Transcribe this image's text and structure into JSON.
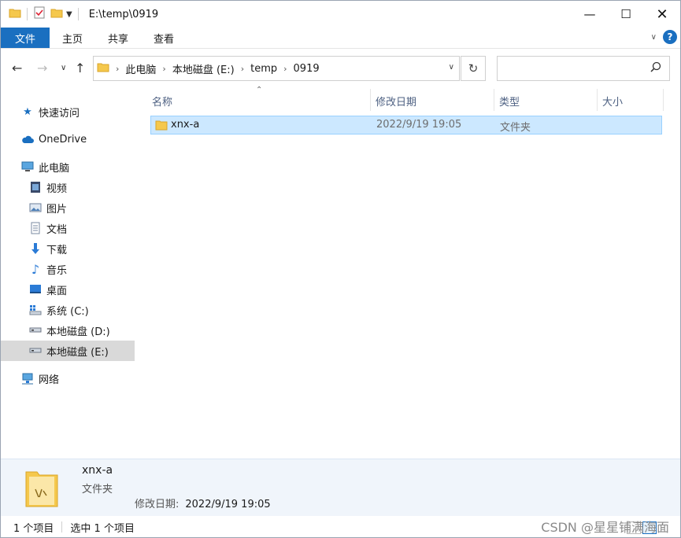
{
  "window": {
    "title": "E:\\temp\\0919"
  },
  "ribbon": {
    "tabs": [
      "文件",
      "主页",
      "共享",
      "查看"
    ]
  },
  "address": {
    "crumbs": [
      "此电脑",
      "本地磁盘 (E:)",
      "temp",
      "0919"
    ]
  },
  "nav": {
    "items": [
      {
        "label": "快速访问",
        "icon": "star-icon"
      },
      {
        "label": "OneDrive",
        "icon": "cloud-icon"
      },
      {
        "label": "此电脑",
        "icon": "pc-icon"
      },
      {
        "label": "视频",
        "icon": "video-icon"
      },
      {
        "label": "图片",
        "icon": "picture-icon"
      },
      {
        "label": "文档",
        "icon": "document-icon"
      },
      {
        "label": "下载",
        "icon": "download-icon"
      },
      {
        "label": "音乐",
        "icon": "music-icon"
      },
      {
        "label": "桌面",
        "icon": "desktop-icon"
      },
      {
        "label": "系统 (C:)",
        "icon": "system-drive-icon"
      },
      {
        "label": "本地磁盘 (D:)",
        "icon": "drive-icon"
      },
      {
        "label": "本地磁盘 (E:)",
        "icon": "drive-icon"
      },
      {
        "label": "网络",
        "icon": "network-icon"
      }
    ]
  },
  "columns": {
    "name": "名称",
    "modified": "修改日期",
    "type": "类型",
    "size": "大小"
  },
  "files": [
    {
      "name": "xnx-a",
      "modified": "2022/9/19 19:05",
      "type": "文件夹",
      "size": ""
    }
  ],
  "details": {
    "name": "xnx-a",
    "type": "文件夹",
    "modified_label": "修改日期:",
    "modified_value": "2022/9/19 19:05"
  },
  "status": {
    "count": "1 个项目",
    "selected": "选中 1 个项目"
  },
  "watermark": "CSDN @星星铺满海面",
  "colors": {
    "accent": "#1a6fc0",
    "selection": "#cce8ff",
    "folder": "#f5c84c"
  }
}
